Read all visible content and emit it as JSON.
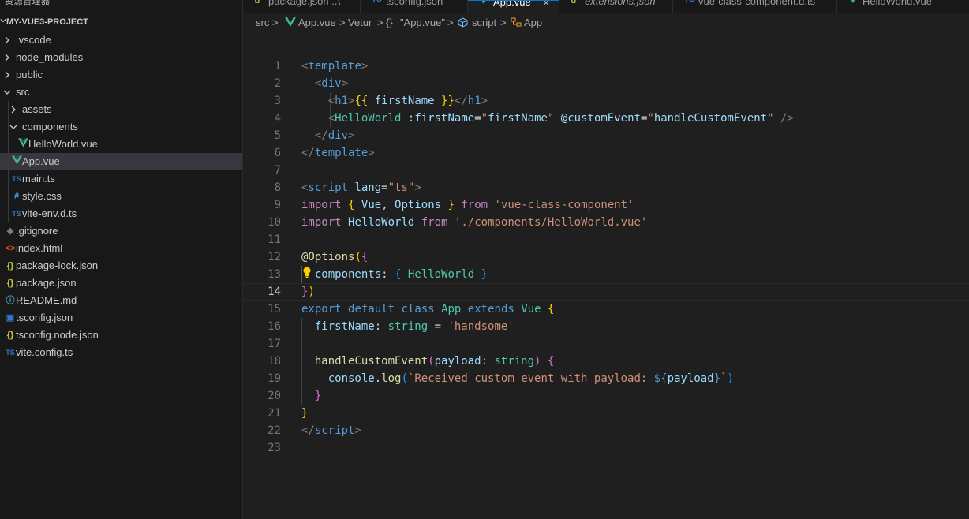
{
  "sidebar": {
    "title": "资源管理器",
    "more": "···",
    "project": "MY-VUE3-PROJECT",
    "items": [
      {
        "label": ".vscode",
        "icon": "folder-chevron",
        "iconText": ""
      },
      {
        "label": "node_modules",
        "icon": "folder-chevron",
        "iconText": ""
      },
      {
        "label": "public",
        "icon": "folder-chevron",
        "iconText": ""
      },
      {
        "label": "src",
        "icon": "folder-open-chevron",
        "iconText": ""
      },
      {
        "label": "assets",
        "icon": "folder-chevron",
        "iconText": ""
      },
      {
        "label": "components",
        "icon": "folder-open-chevron",
        "iconText": ""
      },
      {
        "label": "HelloWorld.vue",
        "icon": "vue-icon",
        "iconText": ""
      },
      {
        "label": "App.vue",
        "icon": "vue-icon",
        "iconText": ""
      },
      {
        "label": "main.ts",
        "icon": "typescript-icon",
        "iconText": "TS"
      },
      {
        "label": "style.css",
        "icon": "css-icon",
        "iconText": "#"
      },
      {
        "label": "vite-env.d.ts",
        "icon": "typescript-icon",
        "iconText": "TS"
      },
      {
        "label": ".gitignore",
        "icon": "git-icon",
        "iconText": "◆"
      },
      {
        "label": "index.html",
        "icon": "html-icon",
        "iconText": "<>"
      },
      {
        "label": "package-lock.json",
        "icon": "json-icon",
        "iconText": "{}"
      },
      {
        "label": "package.json",
        "icon": "json-icon",
        "iconText": "{}"
      },
      {
        "label": "README.md",
        "icon": "info-icon",
        "iconText": "ⓘ"
      },
      {
        "label": "tsconfig.json",
        "icon": "tsconfig-icon",
        "iconText": "▣"
      },
      {
        "label": "tsconfig.node.json",
        "icon": "json-icon",
        "iconText": "{}"
      },
      {
        "label": "vite.config.ts",
        "icon": "typescript-icon",
        "iconText": "TS"
      }
    ]
  },
  "tabs": [
    {
      "label": "package.json ..\\",
      "icon": "json-icon",
      "iconText": "{}"
    },
    {
      "label": "tsconfig.json",
      "icon": "typescript-icon",
      "iconText": "TS"
    },
    {
      "label": "App.vue",
      "icon": "vue-icon",
      "iconText": "",
      "close": "×"
    },
    {
      "label": "extensions.json",
      "icon": "json-icon",
      "iconText": "{}"
    },
    {
      "label": "vue-class-component.d.ts",
      "icon": "typescript-icon",
      "iconText": "TS"
    },
    {
      "label": "HelloWorld.vue",
      "icon": "vue-icon",
      "iconText": ""
    }
  ],
  "breadcrumb": {
    "src": "src",
    "file": "App.vue",
    "vetur": "Vetur",
    "braces": "{}",
    "block": "\"App.vue\"",
    "script": "script",
    "app": "App",
    "sep": ">"
  },
  "editor": {
    "current_line": 14,
    "colors": {
      "tag": "#808080",
      "tagname": "#569cd6",
      "attr": "#9cdcfe",
      "str": "#ce9178",
      "kw": "#c586c0",
      "kwb": "#569cd6",
      "cls": "#4ec9b0",
      "fn": "#dcdcaa",
      "txt": "#d4d4d4",
      "brace": "#ffd700",
      "brace2": "#da70d6",
      "brace3": "#179fff"
    },
    "lines": [
      [
        [
          "tag",
          "<"
        ],
        [
          "tagname",
          "template"
        ],
        [
          "tag",
          ">"
        ]
      ],
      [
        [
          "txt",
          "  "
        ],
        [
          "tag",
          "<"
        ],
        [
          "tagname",
          "div"
        ],
        [
          "tag",
          ">"
        ]
      ],
      [
        [
          "txt",
          "    "
        ],
        [
          "tag",
          "<"
        ],
        [
          "tagname",
          "h1"
        ],
        [
          "tag",
          ">"
        ],
        [
          "brace",
          "{{"
        ],
        [
          "txt",
          " "
        ],
        [
          "attr",
          "firstName"
        ],
        [
          "txt",
          " "
        ],
        [
          "brace",
          "}}"
        ],
        [
          "tag",
          "</"
        ],
        [
          "tagname",
          "h1"
        ],
        [
          "tag",
          ">"
        ]
      ],
      [
        [
          "txt",
          "    "
        ],
        [
          "tag",
          "<"
        ],
        [
          "cls",
          "HelloWorld"
        ],
        [
          "txt",
          " "
        ],
        [
          "attr",
          ":firstName"
        ],
        [
          "txt",
          "="
        ],
        [
          "str",
          "\""
        ],
        [
          "attr",
          "firstName"
        ],
        [
          "str",
          "\""
        ],
        [
          "txt",
          " "
        ],
        [
          "attr",
          "@customEvent"
        ],
        [
          "txt",
          "="
        ],
        [
          "str",
          "\""
        ],
        [
          "attr",
          "handleCustomEvent"
        ],
        [
          "str",
          "\""
        ],
        [
          "txt",
          " "
        ],
        [
          "tag",
          "/>"
        ]
      ],
      [
        [
          "txt",
          "  "
        ],
        [
          "tag",
          "</"
        ],
        [
          "tagname",
          "div"
        ],
        [
          "tag",
          ">"
        ]
      ],
      [
        [
          "tag",
          "</"
        ],
        [
          "tagname",
          "template"
        ],
        [
          "tag",
          ">"
        ]
      ],
      [],
      [
        [
          "tag",
          "<"
        ],
        [
          "tagname",
          "script"
        ],
        [
          "txt",
          " "
        ],
        [
          "attr",
          "lang"
        ],
        [
          "txt",
          "="
        ],
        [
          "str",
          "\"ts\""
        ],
        [
          "tag",
          ">"
        ]
      ],
      [
        [
          "kw",
          "import"
        ],
        [
          "txt",
          " "
        ],
        [
          "brace",
          "{"
        ],
        [
          "txt",
          " "
        ],
        [
          "attr",
          "Vue"
        ],
        [
          "txt",
          ", "
        ],
        [
          "attr",
          "Options"
        ],
        [
          "txt",
          " "
        ],
        [
          "brace",
          "}"
        ],
        [
          "txt",
          " "
        ],
        [
          "kw",
          "from"
        ],
        [
          "txt",
          " "
        ],
        [
          "str",
          "'vue-class-component'"
        ]
      ],
      [
        [
          "kw",
          "import"
        ],
        [
          "txt",
          " "
        ],
        [
          "attr",
          "HelloWorld"
        ],
        [
          "txt",
          " "
        ],
        [
          "kw",
          "from"
        ],
        [
          "txt",
          " "
        ],
        [
          "str",
          "'./components/HelloWorld.vue'"
        ]
      ],
      [],
      [
        [
          "fn",
          "@Options"
        ],
        [
          "brace",
          "("
        ],
        [
          "brace2",
          "{"
        ]
      ],
      [
        [
          "txt",
          "  "
        ],
        [
          "attr",
          "components"
        ],
        [
          "txt",
          ": "
        ],
        [
          "brace3",
          "{"
        ],
        [
          "txt",
          " "
        ],
        [
          "cls",
          "HelloWorld"
        ],
        [
          "txt",
          " "
        ],
        [
          "brace3",
          "}"
        ]
      ],
      [
        [
          "brace2",
          "}"
        ],
        [
          "brace",
          ")"
        ]
      ],
      [
        [
          "kwb",
          "export"
        ],
        [
          "txt",
          " "
        ],
        [
          "kwb",
          "default"
        ],
        [
          "txt",
          " "
        ],
        [
          "kwb",
          "class"
        ],
        [
          "txt",
          " "
        ],
        [
          "cls",
          "App"
        ],
        [
          "txt",
          " "
        ],
        [
          "kwb",
          "extends"
        ],
        [
          "txt",
          " "
        ],
        [
          "cls",
          "Vue"
        ],
        [
          "txt",
          " "
        ],
        [
          "brace",
          "{"
        ]
      ],
      [
        [
          "txt",
          "  "
        ],
        [
          "attr",
          "firstName"
        ],
        [
          "txt",
          ": "
        ],
        [
          "cls",
          "string"
        ],
        [
          "txt",
          " = "
        ],
        [
          "str",
          "'handsome'"
        ]
      ],
      [],
      [
        [
          "txt",
          "  "
        ],
        [
          "fn",
          "handleCustomEvent"
        ],
        [
          "brace2",
          "("
        ],
        [
          "attr",
          "payload"
        ],
        [
          "txt",
          ": "
        ],
        [
          "cls",
          "string"
        ],
        [
          "brace2",
          ")"
        ],
        [
          "txt",
          " "
        ],
        [
          "brace2",
          "{"
        ]
      ],
      [
        [
          "txt",
          "    "
        ],
        [
          "attr",
          "console"
        ],
        [
          "txt",
          "."
        ],
        [
          "fn",
          "log"
        ],
        [
          "brace3",
          "("
        ],
        [
          "str",
          "`Received custom event with payload: "
        ],
        [
          "kwb",
          "${"
        ],
        [
          "attr",
          "payload"
        ],
        [
          "kwb",
          "}"
        ],
        [
          "str",
          "`"
        ],
        [
          "brace3",
          ")"
        ]
      ],
      [
        [
          "txt",
          "  "
        ],
        [
          "brace2",
          "}"
        ]
      ],
      [
        [
          "brace",
          "}"
        ]
      ],
      [
        [
          "tag",
          "</"
        ],
        [
          "tagname",
          "script"
        ],
        [
          "tag",
          ">"
        ]
      ],
      []
    ]
  }
}
